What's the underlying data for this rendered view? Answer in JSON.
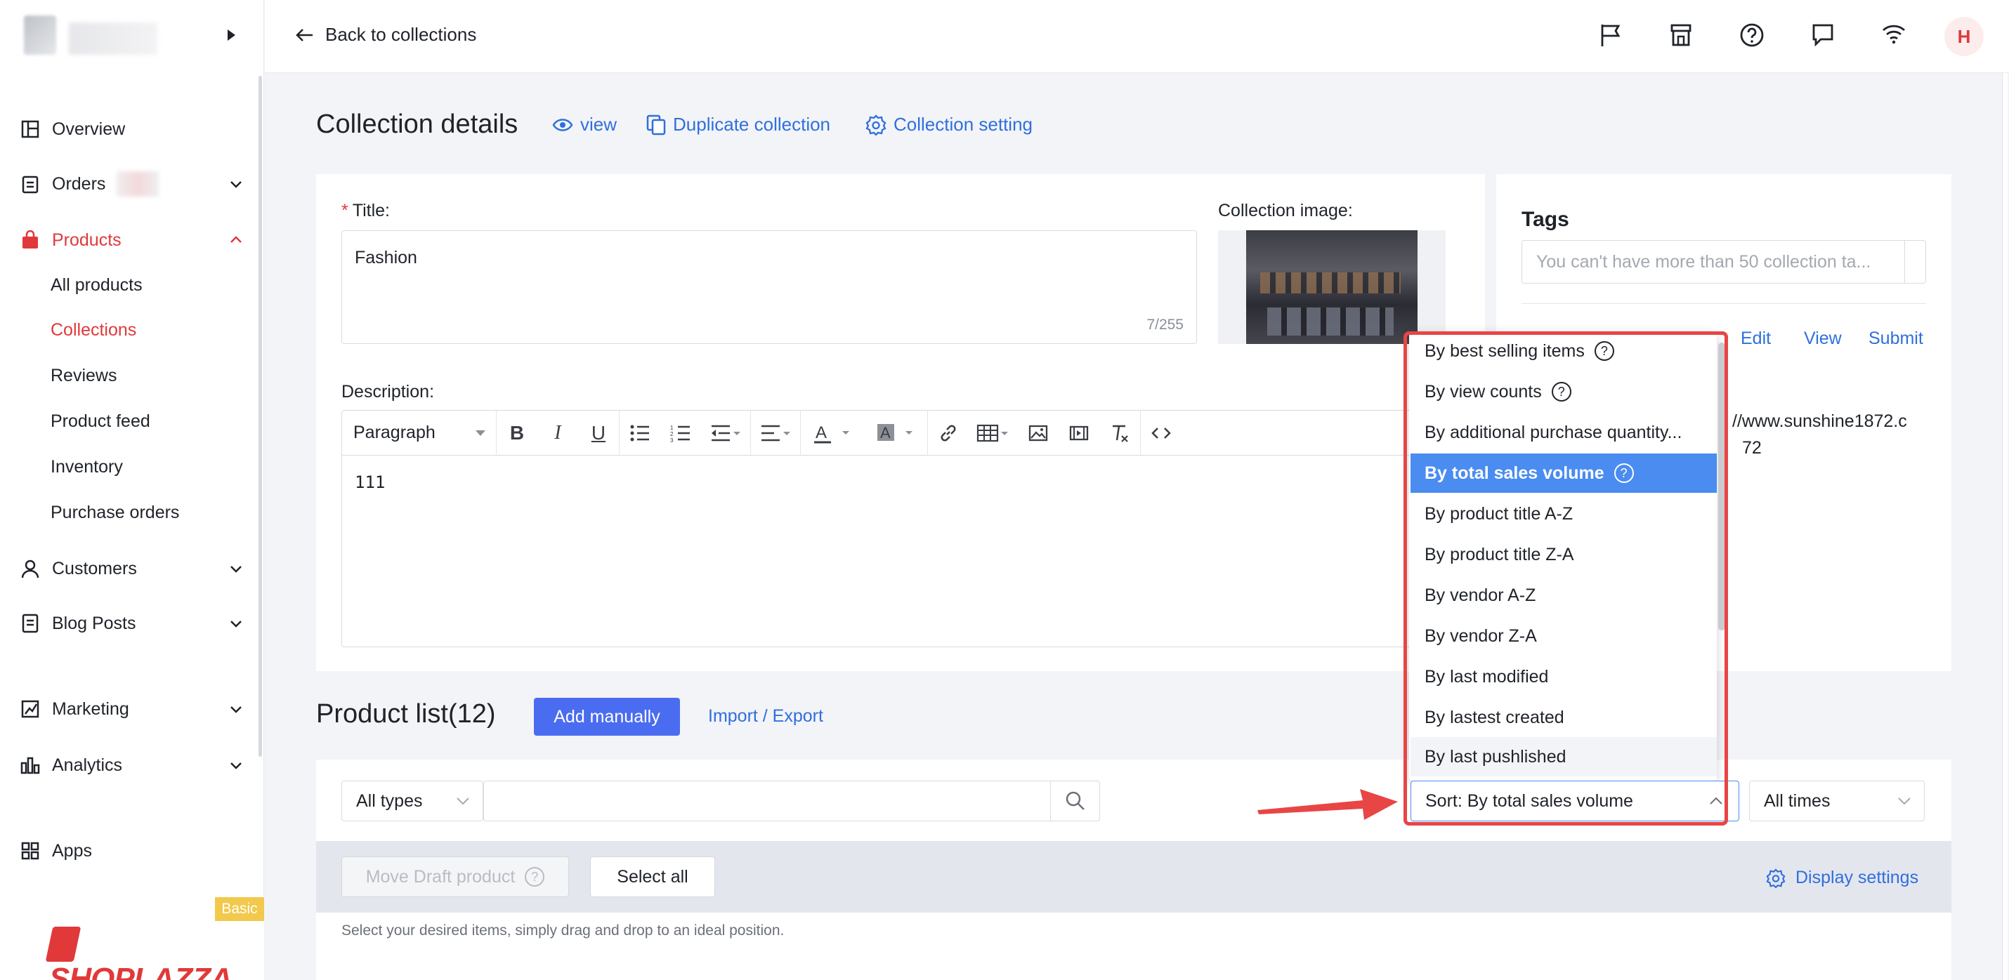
{
  "sidebar": {
    "items": [
      {
        "label": "Overview",
        "icon": "dashboard-icon"
      },
      {
        "label": "Orders",
        "icon": "clipboard-icon"
      },
      {
        "label": "Products",
        "icon": "bag-icon"
      },
      {
        "label": "Customers",
        "icon": "person-icon"
      },
      {
        "label": "Blog Posts",
        "icon": "document-icon"
      },
      {
        "label": "Marketing",
        "icon": "megaphone-icon"
      },
      {
        "label": "Analytics",
        "icon": "bar-chart-icon"
      },
      {
        "label": "Apps",
        "icon": "apps-icon"
      }
    ],
    "product_sub": [
      "All products",
      "Collections",
      "Reviews",
      "Product feed",
      "Inventory",
      "Purchase orders"
    ],
    "active_color": "#e1393a",
    "brand": "SHOPLAZZA",
    "plan_badge": "Basic"
  },
  "header": {
    "back_label": "Back to collections",
    "icons": [
      "flag-icon",
      "store-icon",
      "help-icon",
      "chat-icon",
      "wifi-icon"
    ],
    "avatar": "H"
  },
  "page": {
    "title": "Collection details",
    "view_link": "view",
    "duplicate_link": "Duplicate collection",
    "setting_link": "Collection setting",
    "accent": "#2f6fde"
  },
  "form": {
    "title_label": "Title",
    "title_value": "Fashion",
    "title_counter": "7/255",
    "image_label": "Collection image",
    "desc_label": "Description",
    "paragraph": "Paragraph",
    "body": "111"
  },
  "products": {
    "title": "Product list(12)",
    "add_manually": "Add manually",
    "import_export": "Import / Export",
    "type_filter": "All types",
    "sort_value": "Sort: By total sales volume",
    "time_filter": "All times",
    "move_draft": "Move Draft product",
    "select_all": "Select all",
    "display_settings": "Display settings",
    "hint": "Select your desired items, simply drag and drop to an ideal position."
  },
  "tags": {
    "title": "Tags",
    "placeholder": "You can't have more than 50 collection ta...",
    "edit": "Edit",
    "view": "View",
    "submit": "Submit",
    "url_line1": "//www.sunshine1872.c",
    "url_line2": "72"
  },
  "sort_options": [
    {
      "label": "By best selling items",
      "help": true
    },
    {
      "label": "By view counts",
      "help": true
    },
    {
      "label": "By additional purchase quantity...",
      "help": false
    },
    {
      "label": "By total sales volume",
      "help": true,
      "selected": true
    },
    {
      "label": "By product title A-Z",
      "help": false
    },
    {
      "label": "By product title Z-A",
      "help": false
    },
    {
      "label": "By vendor A-Z",
      "help": false
    },
    {
      "label": "By vendor Z-A",
      "help": false
    },
    {
      "label": "By last modified",
      "help": false
    },
    {
      "label": "By lastest created",
      "help": false
    },
    {
      "label": "By last pushlished",
      "help": false
    }
  ],
  "annotation_color": "#e84545"
}
